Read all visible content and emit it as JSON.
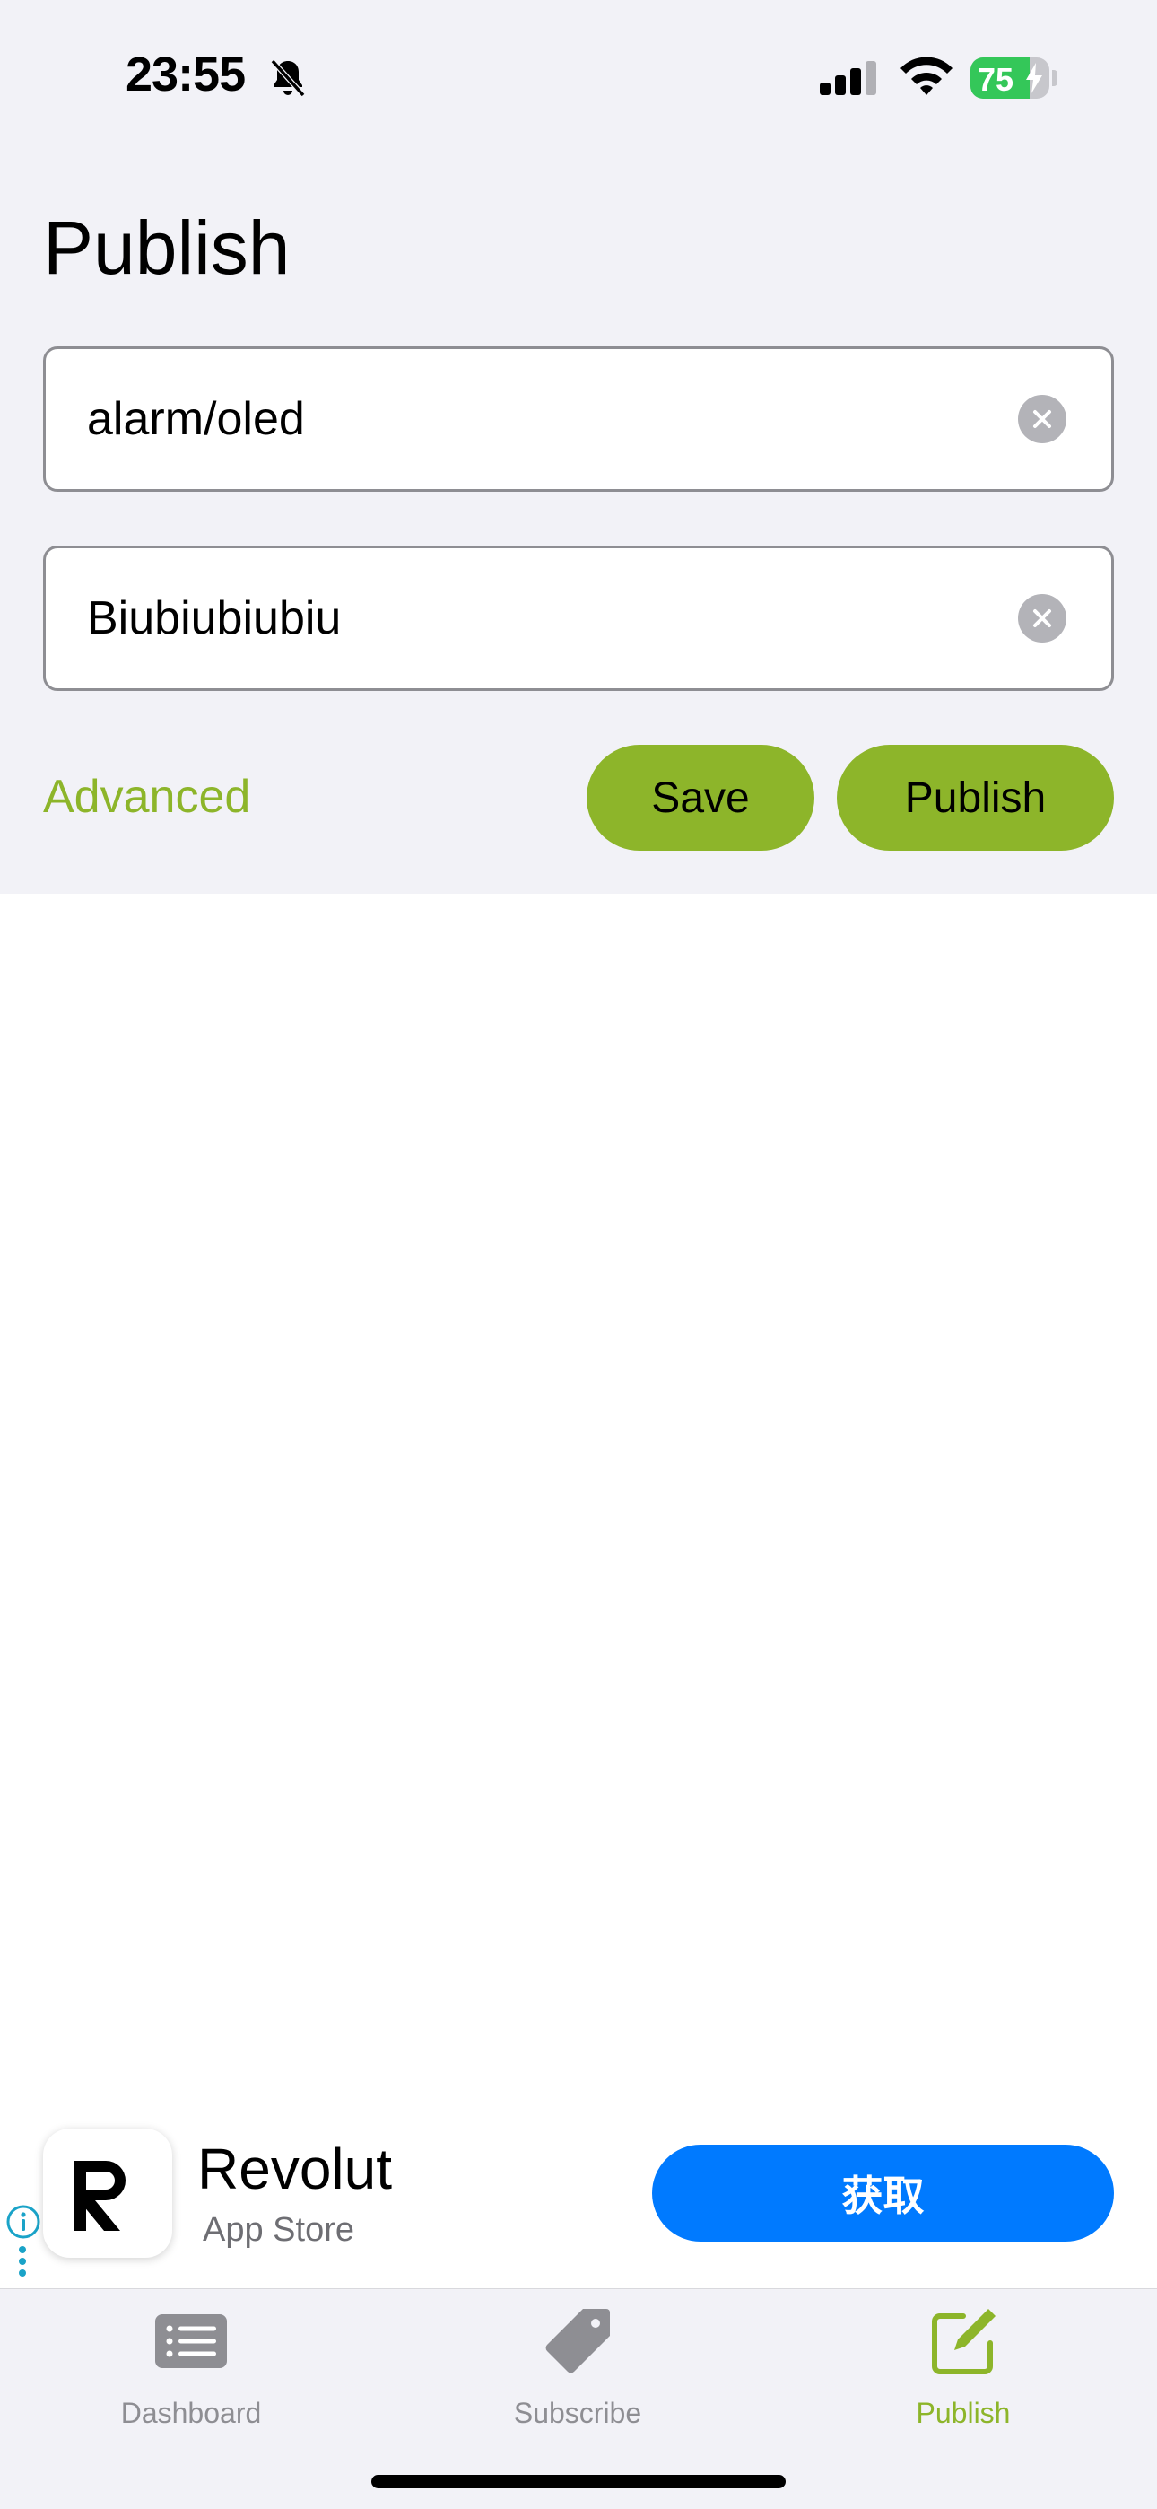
{
  "status_bar": {
    "time": "23:55",
    "battery_text": "75",
    "battery_level": 0.75,
    "icons": [
      "bell-slash-icon",
      "cellular-signal-icon",
      "wifi-icon",
      "battery-charging-icon"
    ]
  },
  "page": {
    "title": "Publish"
  },
  "form": {
    "topic_value": "alarm/oled",
    "message_value": "Biubiubiubiu",
    "advanced_label": "Advanced",
    "save_label": "Save",
    "publish_label": "Publish"
  },
  "ad": {
    "app_name": "Revolut",
    "store": "App Store",
    "get_label": "获取",
    "icons": [
      "info-icon",
      "more-dots-icon",
      "revolut-logo"
    ]
  },
  "tab_bar": {
    "items": [
      {
        "label": "Dashboard",
        "icon": "list-icon",
        "active": false
      },
      {
        "label": "Subscribe",
        "icon": "tag-icon",
        "active": false
      },
      {
        "label": "Publish",
        "icon": "compose-icon",
        "active": true
      }
    ]
  },
  "colors": {
    "accent": "#8db52a",
    "get_button": "#007aff",
    "background_top": "#f2f2f7",
    "battery_green": "#34c759"
  }
}
